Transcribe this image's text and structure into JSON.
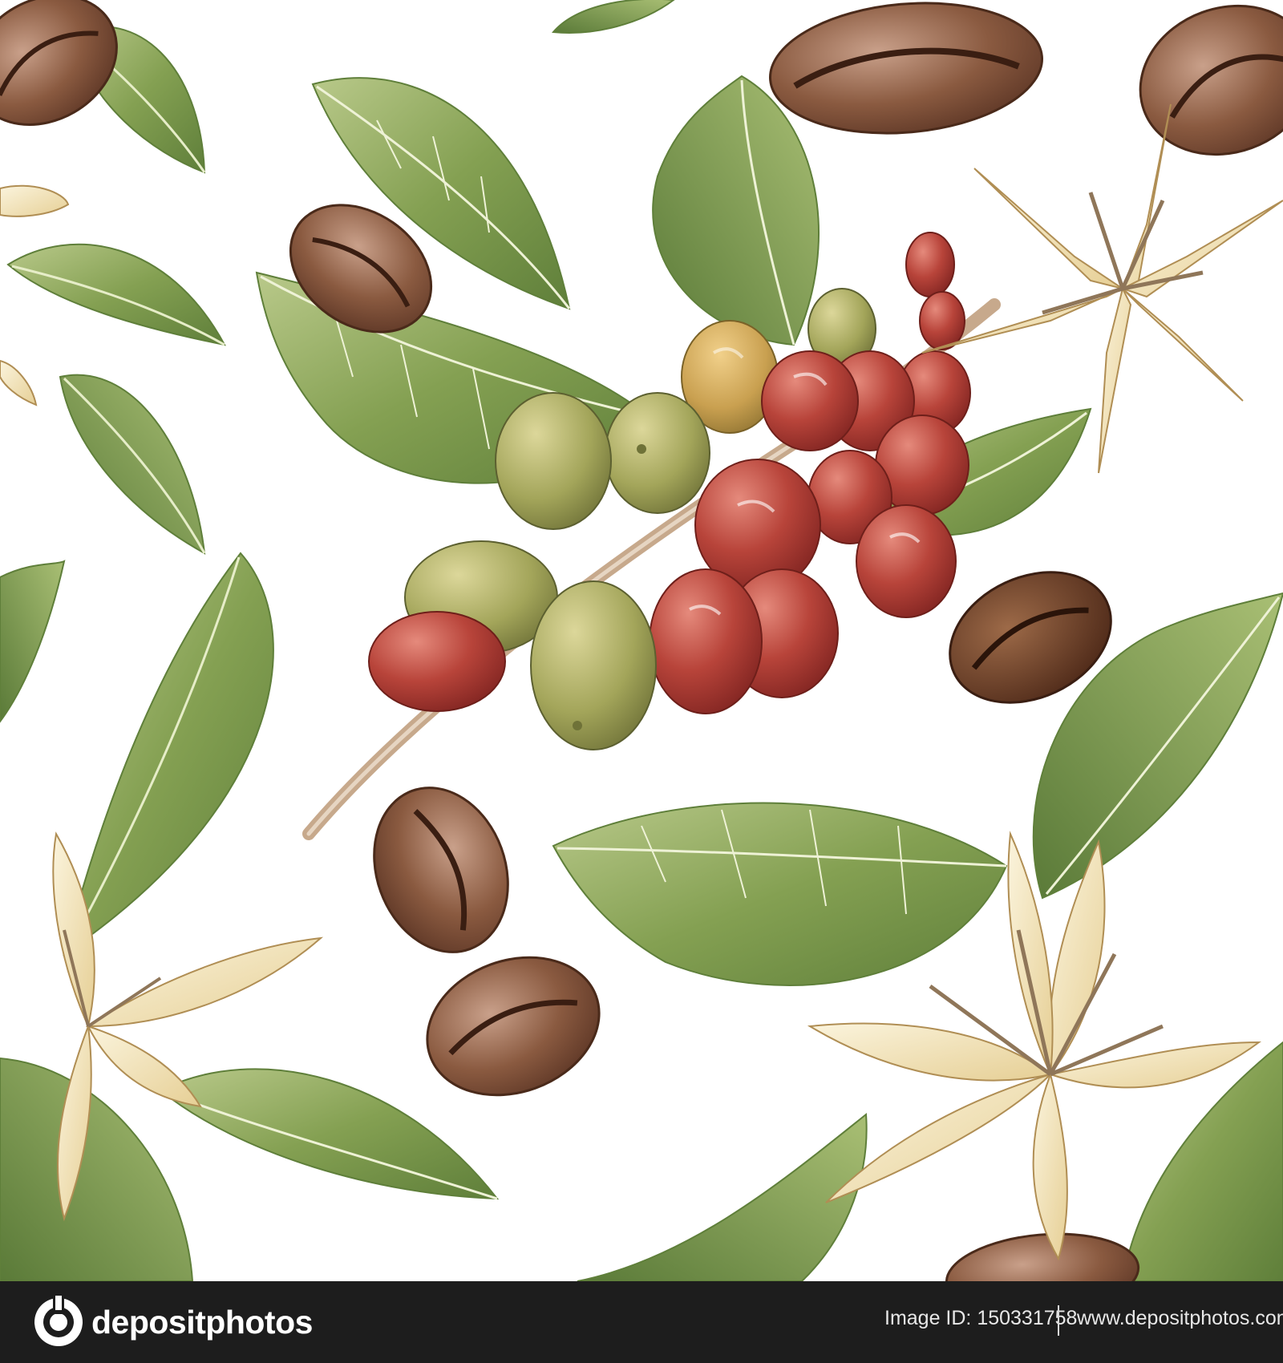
{
  "artwork": {
    "subject_icons": [
      "coffee-leaf",
      "coffee-bean",
      "coffee-berry",
      "coffee-flower"
    ],
    "colors": {
      "background": "#ffffff",
      "leaf_dark": "#5f7f3a",
      "leaf_light": "#b9c98a",
      "berry_red": "#a8362b",
      "berry_green": "#a3a55a",
      "bean_brown": "#7b4a32",
      "flower_cream": "#f4e7c5"
    },
    "watermark_text": "depositphotos"
  },
  "footer": {
    "brand_name": "depositphotos",
    "image_id": "Image ID: 150331758",
    "site_url": "www.depositphotos.com",
    "background_color": "#1d1d1d"
  }
}
